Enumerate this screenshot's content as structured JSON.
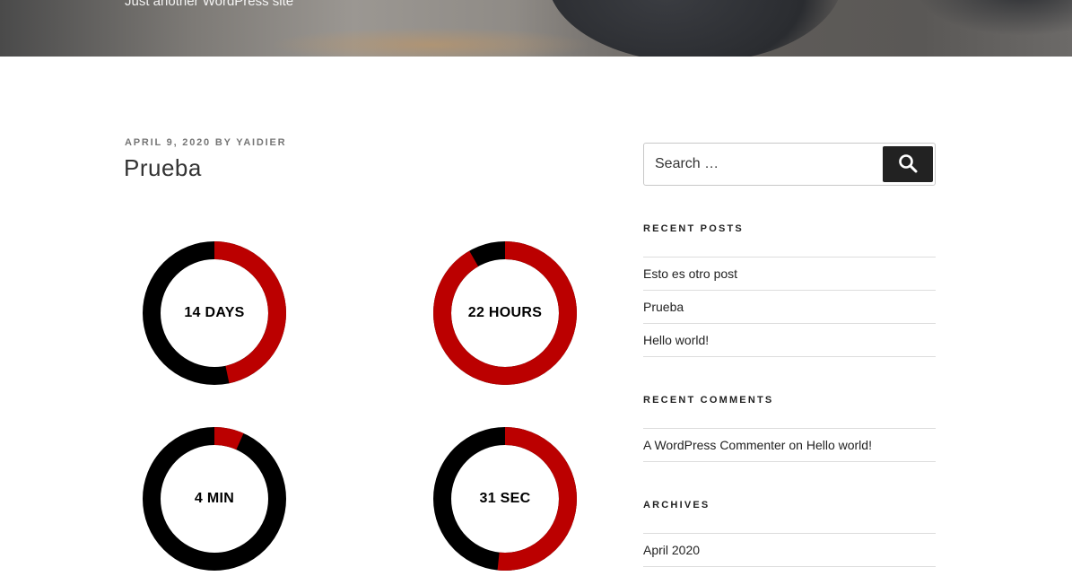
{
  "header": {
    "tagline": "Just another WordPress site"
  },
  "post": {
    "date": "April 9, 2020",
    "by": "by",
    "author": "Yaidier",
    "title": "Prueba"
  },
  "countdown": {
    "track_color": "#000000",
    "fill_color": "#bb0000",
    "units": [
      {
        "label": "14 DAYS",
        "value": 14,
        "max": 30,
        "start_fraction": 0.0
      },
      {
        "label": "22 HOURS",
        "value": 22,
        "max": 24,
        "start_fraction": 0.0
      },
      {
        "label": "4 MIN",
        "value": 4,
        "max": 60,
        "start_fraction": 0.0
      },
      {
        "label": "31 SEC",
        "value": 31,
        "max": 60,
        "start_fraction": 0.0
      }
    ]
  },
  "search": {
    "placeholder": "Search …",
    "button_icon": "search-icon"
  },
  "recent_posts": {
    "title": "Recent Posts",
    "items": [
      "Esto es otro post",
      "Prueba",
      "Hello world!"
    ]
  },
  "recent_comments": {
    "title": "Recent Comments",
    "author": "A WordPress Commenter",
    "on": "on",
    "post": "Hello world!"
  },
  "archives": {
    "title": "Archives",
    "items": [
      "April 2020"
    ]
  }
}
